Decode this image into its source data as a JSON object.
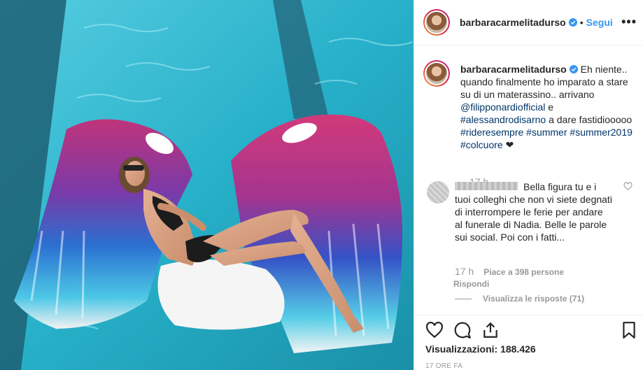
{
  "post": {
    "username": "barbaracarmelitadurso",
    "follow_label": "Segui",
    "dot": "•",
    "more_label": "•••"
  },
  "caption": {
    "username": "barbaracarmelitadurso",
    "text_part1": " Eh niente.. quando finalmente ho imparato a stare su di un materassino.. arrivano ",
    "mention1": "@filipponardiofficial",
    "text_part2": " e ",
    "tag1": "#alessandrodisarno",
    "text_part3": " a dare fastidiooooo ",
    "tag2": "#rideresempre",
    "tag3": "#summer",
    "tag4": "#summer2019",
    "tag5": "#colcuore",
    "emoji": " ❤",
    "time": "17 h"
  },
  "comment": {
    "text": "Bella figura tu e i tuoi colleghi che non vi siete degnati di interrompere le ferie per andare al funerale di Nadia. Belle le parole sui social. Poi con i fatti...",
    "time": "17 h",
    "likes": "Piace a 398 persone",
    "reply_label": "Rispondi",
    "view_replies": "Visualizza le risposte (71)"
  },
  "footer": {
    "views": "Visualizzazioni: 188.426",
    "date": "17 ORE FA"
  },
  "colors": {
    "accent_blue": "#3897f0",
    "link": "#003569",
    "muted": "#999999",
    "verified": "#3897f0"
  },
  "icons": [
    "heart-icon",
    "comment-icon",
    "share-icon",
    "bookmark-icon",
    "verified-badge-icon",
    "more-options-icon"
  ]
}
